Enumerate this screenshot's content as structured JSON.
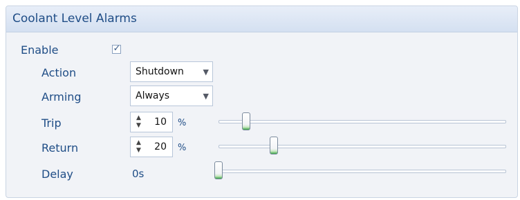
{
  "panel": {
    "title": "Coolant Level Alarms"
  },
  "enable": {
    "label": "Enable",
    "checked": true,
    "check_glyph": "✓"
  },
  "action": {
    "label": "Action",
    "value": "Shutdown",
    "arrow": "▼"
  },
  "arming": {
    "label": "Arming",
    "value": "Always",
    "arrow": "▼"
  },
  "trip": {
    "label": "Trip",
    "value": "10",
    "unit": "%",
    "level": 10
  },
  "return": {
    "label": "Return",
    "value": "20",
    "unit": "%",
    "level": 20
  },
  "delay": {
    "label": "Delay",
    "value": "0s",
    "level": 0
  },
  "spinner": {
    "up_glyph": "▲",
    "down_glyph": "▼"
  },
  "colors": {
    "title_text": "#1f4d86",
    "thumb_accent": "#3aa447"
  }
}
